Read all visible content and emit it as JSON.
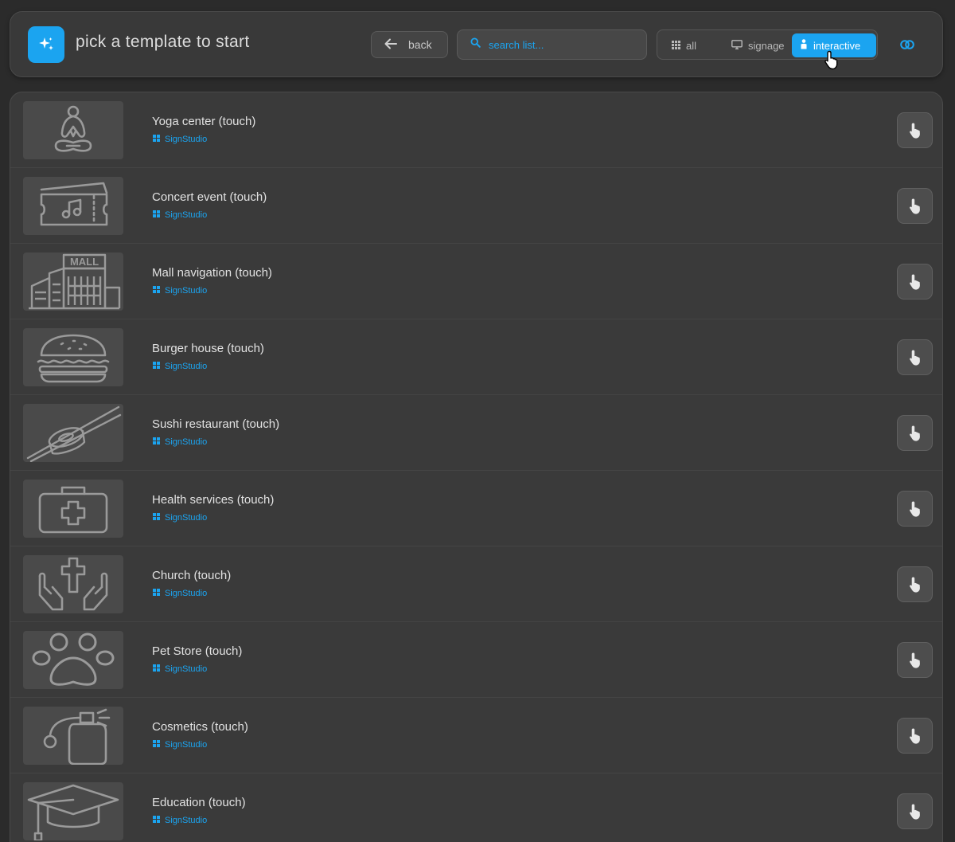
{
  "header": {
    "logo_icon": "sparkles-icon",
    "title": "pick a template to start",
    "back_label": "back",
    "search_placeholder": "search list...",
    "filters": [
      {
        "label": "all",
        "icon": "grid-icon",
        "active": false
      },
      {
        "label": "signage",
        "icon": "monitor-icon",
        "active": false
      },
      {
        "label": "interactive",
        "icon": "touch-person-icon",
        "active": true
      }
    ],
    "link_icon": "link-rings-icon"
  },
  "colors": {
    "accent": "#1ba4f0",
    "background": "#2b2b2b",
    "panel": "#3a3a3a"
  },
  "templates": [
    {
      "title": "Yoga center (touch)",
      "source": "SignStudio",
      "thumb_icon": "yoga-icon"
    },
    {
      "title": "Concert event (touch)",
      "source": "SignStudio",
      "thumb_icon": "ticket-music-icon"
    },
    {
      "title": "Mall navigation (touch)",
      "source": "SignStudio",
      "thumb_icon": "mall-icon",
      "thumb_text": "MALL"
    },
    {
      "title": "Burger house (touch)",
      "source": "SignStudio",
      "thumb_icon": "burger-icon"
    },
    {
      "title": "Sushi restaurant (touch)",
      "source": "SignStudio",
      "thumb_icon": "sushi-icon"
    },
    {
      "title": "Health services (touch)",
      "source": "SignStudio",
      "thumb_icon": "medical-kit-icon"
    },
    {
      "title": "Church (touch)",
      "source": "SignStudio",
      "thumb_icon": "church-hands-icon"
    },
    {
      "title": "Pet Store (touch)",
      "source": "SignStudio",
      "thumb_icon": "paw-icon"
    },
    {
      "title": "Cosmetics (touch)",
      "source": "SignStudio",
      "thumb_icon": "perfume-icon"
    },
    {
      "title": "Education (touch)",
      "source": "SignStudio",
      "thumb_icon": "graduation-cap-icon"
    }
  ]
}
